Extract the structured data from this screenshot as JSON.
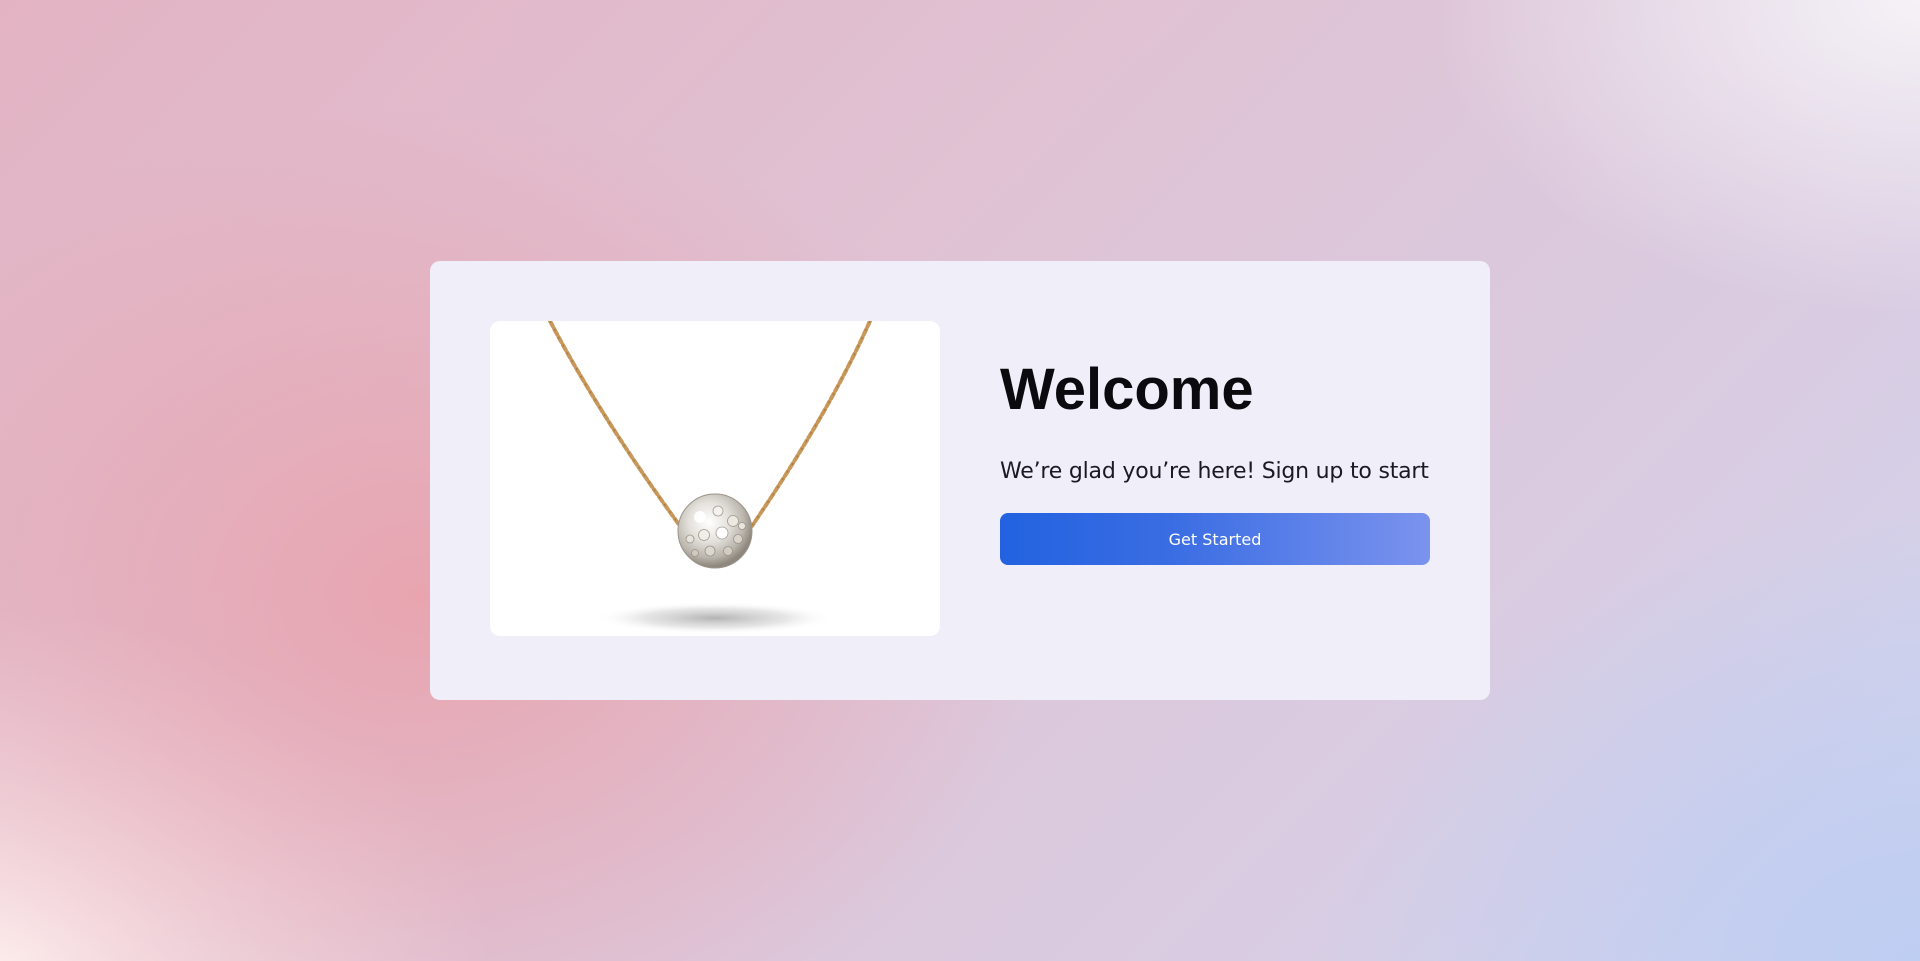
{
  "welcome": {
    "title": "Welcome",
    "subtitle": "We’re glad you’re here! Sign up to start",
    "cta_label": "Get Started"
  },
  "image": {
    "subject": "necklace-pendant",
    "alt": ""
  },
  "colors": {
    "card_background": "#f0eef8",
    "button_start": "#2262e0",
    "button_end": "#7b93ee",
    "title_text": "#0b0b0f"
  }
}
